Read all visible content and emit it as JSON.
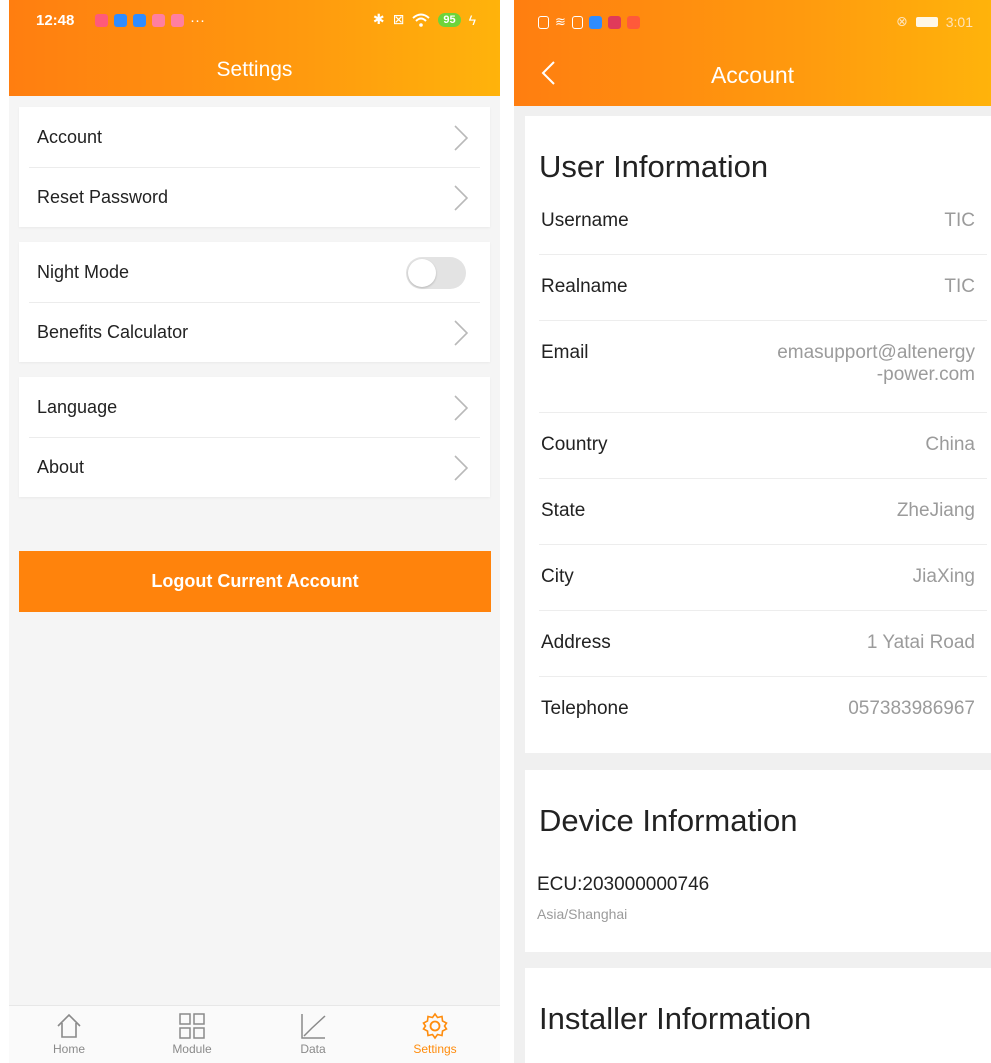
{
  "left": {
    "status": {
      "time": "12:48",
      "more": "···",
      "battery": "95"
    },
    "title": "Settings",
    "groups": [
      [
        {
          "label": "Account"
        },
        {
          "label": "Reset Password"
        }
      ],
      [
        {
          "label": "Night Mode"
        },
        {
          "label": "Benefits Calculator"
        }
      ],
      [
        {
          "label": "Language"
        },
        {
          "label": "About"
        }
      ]
    ],
    "night_mode_on": false,
    "logout_label": "Logout Current Account",
    "tabs": [
      {
        "label": "Home",
        "icon": "home-icon"
      },
      {
        "label": "Module",
        "icon": "grid-icon"
      },
      {
        "label": "Data",
        "icon": "chart-icon"
      },
      {
        "label": "Settings",
        "icon": "gear-icon",
        "active": true
      }
    ],
    "accent": "#ff830c"
  },
  "right": {
    "status": {
      "time": "3:01"
    },
    "title": "Account",
    "user_section": "User Information",
    "user_fields": [
      {
        "label": "Username",
        "value": "TIC"
      },
      {
        "label": "Realname",
        "value": "TIC"
      },
      {
        "label": "Email",
        "value_line1": "emasupport@altenergy",
        "value_line2": "-power.com"
      },
      {
        "label": "Country",
        "value": "China"
      },
      {
        "label": "State",
        "value": "ZheJiang"
      },
      {
        "label": "City",
        "value": "JiaXing"
      },
      {
        "label": "Address",
        "value": "1 Yatai Road"
      },
      {
        "label": "Telephone",
        "value": "057383986967"
      }
    ],
    "device_section": "Device Information",
    "device": {
      "ecu": "ECU:203000000746",
      "timezone": "Asia/Shanghai"
    },
    "installer_section": "Installer Information"
  }
}
